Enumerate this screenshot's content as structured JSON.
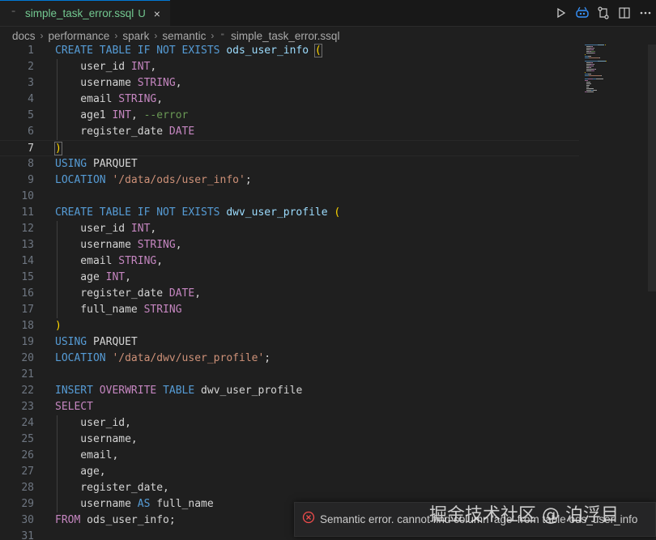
{
  "tab": {
    "label": "simple_task_error.ssql",
    "status": "U",
    "close": "×"
  },
  "breadcrumb": [
    "docs",
    "performance",
    "spark",
    "semantic",
    "simple_task_error.ssql"
  ],
  "actions": [
    "run-icon",
    "copilot-icon",
    "source-control-compare-icon",
    "split-editor-icon",
    "more-actions-icon"
  ],
  "colors": {
    "keyword": "#569cd6",
    "type": "#c586c0",
    "string": "#ce9178",
    "comment": "#6a9955",
    "identifier": "#9cdcfe",
    "bracket": "#ffd700",
    "tab_label": "#73c991",
    "error": "#f14c4c"
  },
  "editor": {
    "lines": [
      [
        [
          "kw",
          "CREATE TABLE IF NOT EXISTS "
        ],
        [
          "id",
          "ods_user_info"
        ],
        [
          "pl",
          " "
        ],
        [
          "brx",
          "("
        ]
      ],
      [
        [
          "pl",
          "    user_id "
        ],
        [
          "ty",
          "INT"
        ],
        [
          "pl",
          ","
        ]
      ],
      [
        [
          "pl",
          "    username "
        ],
        [
          "ty",
          "STRING"
        ],
        [
          "pl",
          ","
        ]
      ],
      [
        [
          "pl",
          "    email "
        ],
        [
          "ty",
          "STRING"
        ],
        [
          "pl",
          ","
        ]
      ],
      [
        [
          "pl",
          "    age1 "
        ],
        [
          "ty",
          "INT"
        ],
        [
          "pl",
          ", "
        ],
        [
          "cm",
          "--error"
        ]
      ],
      [
        [
          "pl",
          "    register_date "
        ],
        [
          "ty",
          "DATE"
        ]
      ],
      [
        [
          "brx",
          ")"
        ]
      ],
      [
        [
          "kw",
          "USING "
        ],
        [
          "pl",
          "PARQUET"
        ]
      ],
      [
        [
          "kw",
          "LOCATION "
        ],
        [
          "st",
          "'/data/ods/user_info'"
        ],
        [
          "pl",
          ";"
        ]
      ],
      [],
      [
        [
          "kw",
          "CREATE TABLE IF NOT EXISTS "
        ],
        [
          "id",
          "dwv_user_profile"
        ],
        [
          "pl",
          " "
        ],
        [
          "br",
          "("
        ]
      ],
      [
        [
          "pl",
          "    user_id "
        ],
        [
          "ty",
          "INT"
        ],
        [
          "pl",
          ","
        ]
      ],
      [
        [
          "pl",
          "    username "
        ],
        [
          "ty",
          "STRING"
        ],
        [
          "pl",
          ","
        ]
      ],
      [
        [
          "pl",
          "    email "
        ],
        [
          "ty",
          "STRING"
        ],
        [
          "pl",
          ","
        ]
      ],
      [
        [
          "pl",
          "    age "
        ],
        [
          "ty",
          "INT"
        ],
        [
          "pl",
          ","
        ]
      ],
      [
        [
          "pl",
          "    register_date "
        ],
        [
          "ty",
          "DATE"
        ],
        [
          "pl",
          ","
        ]
      ],
      [
        [
          "pl",
          "    full_name "
        ],
        [
          "ty",
          "STRING"
        ]
      ],
      [
        [
          "br",
          ")"
        ]
      ],
      [
        [
          "kw",
          "USING "
        ],
        [
          "pl",
          "PARQUET"
        ]
      ],
      [
        [
          "kw",
          "LOCATION "
        ],
        [
          "st",
          "'/data/dwv/user_profile'"
        ],
        [
          "pl",
          ";"
        ]
      ],
      [],
      [
        [
          "kw",
          "INSERT "
        ],
        [
          "ty",
          "OVERWRITE "
        ],
        [
          "kw",
          "TABLE "
        ],
        [
          "pl",
          "dwv_user_profile"
        ]
      ],
      [
        [
          "ty",
          "SELECT"
        ]
      ],
      [
        [
          "pl",
          "    user_id,"
        ]
      ],
      [
        [
          "pl",
          "    username,"
        ]
      ],
      [
        [
          "pl",
          "    email,"
        ]
      ],
      [
        [
          "pl",
          "    age,"
        ]
      ],
      [
        [
          "pl",
          "    register_date,"
        ]
      ],
      [
        [
          "pl",
          "    username "
        ],
        [
          "kw",
          "AS "
        ],
        [
          "pl",
          "full_name"
        ]
      ],
      [
        [
          "ty",
          "FROM "
        ],
        [
          "pl",
          "ods_user_info;"
        ]
      ],
      []
    ],
    "current_line": 7
  },
  "notification": {
    "message": "Semantic error. cannot find column 'age' from table ods_user_info",
    "icon": "error-icon"
  },
  "watermark": "掘金技术社区 @ 泊浮目"
}
